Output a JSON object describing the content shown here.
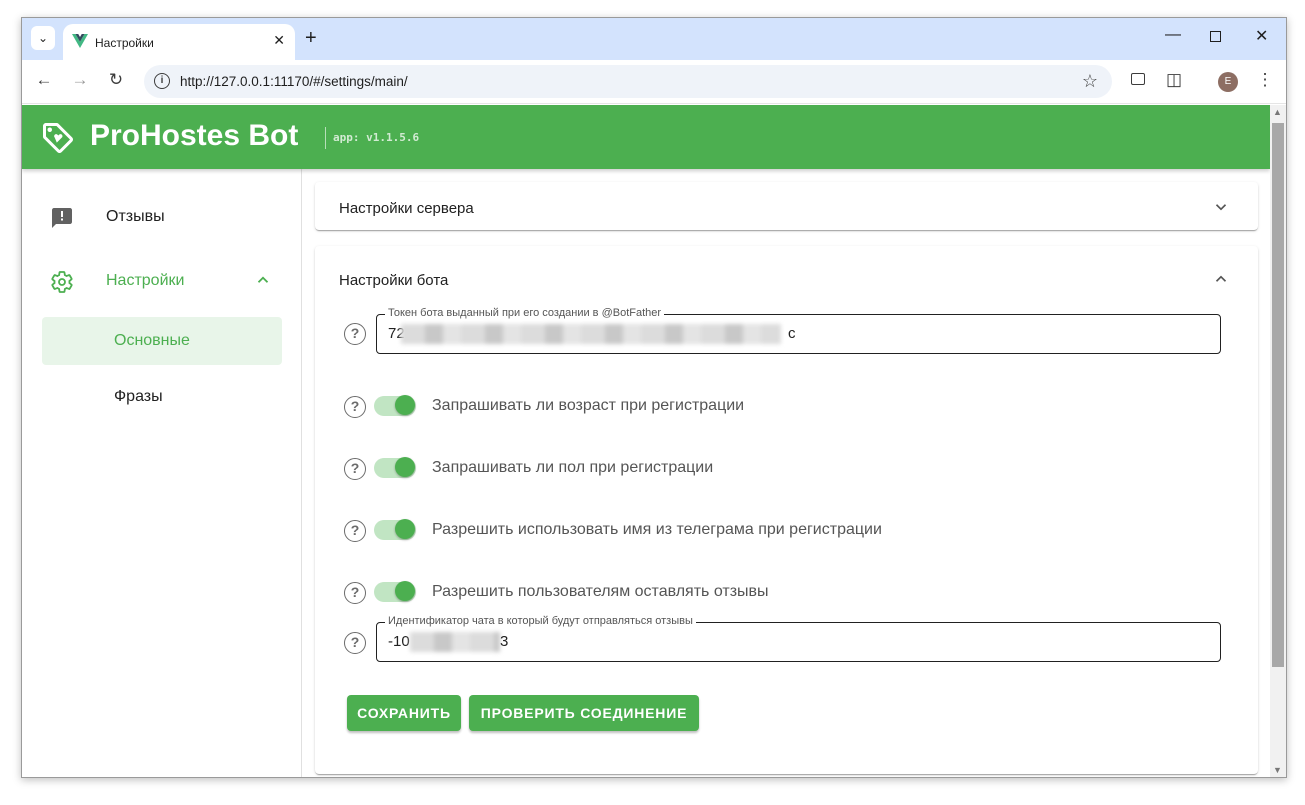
{
  "browser": {
    "tab_title": "Настройки",
    "url": "http://127.0.0.1:11170/#/settings/main/",
    "profile_initial": "E"
  },
  "app": {
    "name": "ProHostes Bot",
    "version": "app: v1.1.5.6",
    "accent_color": "#4caf50"
  },
  "sidebar": {
    "items": [
      {
        "label": "Отзывы",
        "icon": "message-alert-icon"
      },
      {
        "label": "Настройки",
        "icon": "gear-icon",
        "expanded": true
      }
    ],
    "subitems": [
      {
        "label": "Основные",
        "selected": true
      },
      {
        "label": "Фразы",
        "selected": false
      }
    ]
  },
  "panels": {
    "server": {
      "title": "Настройки сервера",
      "expanded": false
    },
    "bot": {
      "title": "Настройки бота",
      "expanded": true,
      "token_field": {
        "label": "Токен бота выданный при его создании в @BotFather",
        "value_start": "72",
        "value_end": "c"
      },
      "toggles": [
        {
          "label": "Запрашивать ли возраст при регистрации",
          "on": true
        },
        {
          "label": "Запрашивать ли пол при регистрации",
          "on": true
        },
        {
          "label": "Разрешить использовать имя из телеграма при регистрации",
          "on": true
        },
        {
          "label": "Разрешить пользователям оставлять отзывы",
          "on": true
        }
      ],
      "chat_field": {
        "label": "Идентификатор чата в который будут отправляться отзывы",
        "value_start": "-10",
        "value_end": "3"
      },
      "save_label": "СОХРАНИТЬ",
      "check_label": "ПРОВЕРИТЬ СОЕДИНЕНИЕ"
    }
  }
}
